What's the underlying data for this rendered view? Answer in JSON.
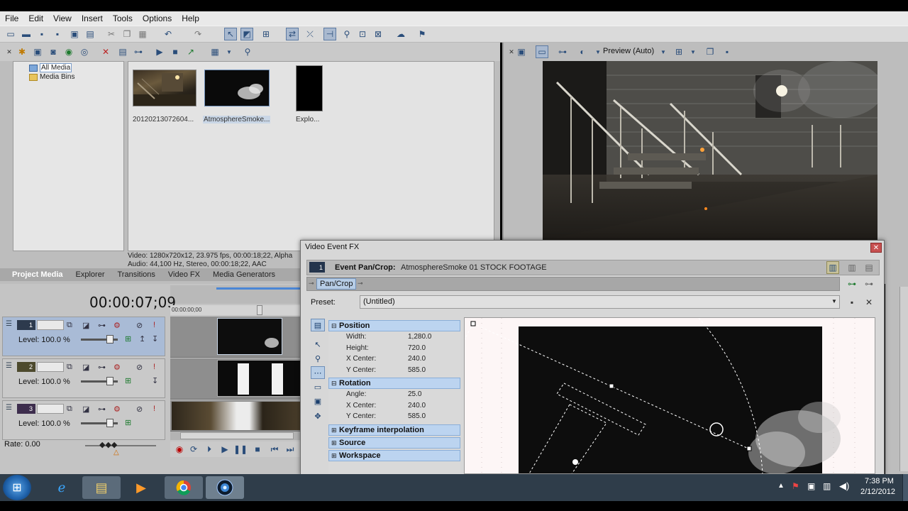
{
  "menubar": {
    "items": [
      "File",
      "Edit",
      "View",
      "Insert",
      "Tools",
      "Options",
      "Help"
    ]
  },
  "project_media": {
    "tree": [
      {
        "label": "All Media",
        "selected": true
      },
      {
        "label": "Media Bins",
        "selected": false
      }
    ],
    "media": [
      {
        "label": "20120213072604...",
        "kind": "video"
      },
      {
        "label": "AtmosphereSmoke...",
        "kind": "smoke"
      },
      {
        "label": "Explo...",
        "kind": "black"
      }
    ],
    "info_video": "Video: 1280x720x12, 23.975 fps, 00:00:18;22, Alpha",
    "info_audio": "Audio: 44,100 Hz, Stereo, 00:00:18;22, AAC"
  },
  "window_tabs": [
    {
      "label": "Project Media",
      "active": true
    },
    {
      "label": "Explorer",
      "active": false
    },
    {
      "label": "Transitions",
      "active": false
    },
    {
      "label": "Video FX",
      "active": false
    },
    {
      "label": "Media Generators",
      "active": false
    }
  ],
  "preview": {
    "quality": "Preview (Auto)"
  },
  "timeline": {
    "timecode": "00:00:07;09",
    "ruler_start": "00:00:00;00",
    "rate_label": "Rate: 0.00",
    "tracks": [
      {
        "number": "1",
        "level": "Level: 100.0 %",
        "selected": true
      },
      {
        "number": "2",
        "level": "Level: 100.0 %",
        "selected": false
      },
      {
        "number": "3",
        "level": "Level: 100.0 %",
        "selected": false
      }
    ]
  },
  "fx_window": {
    "title": "Video Event FX",
    "header_title": "Event Pan/Crop:",
    "header_subtitle": "AtmosphereSmoke 01 STOCK FOOTAGE",
    "chain_tab": "Pan/Crop",
    "preset_label": "Preset:",
    "preset_value": "(Untitled)",
    "sections": [
      {
        "name": "Position",
        "expanded": true,
        "rows": [
          {
            "label": "Width:",
            "value": "1,280.0"
          },
          {
            "label": "Height:",
            "value": "720.0"
          },
          {
            "label": "X Center:",
            "value": "240.0"
          },
          {
            "label": "Y Center:",
            "value": "585.0"
          }
        ]
      },
      {
        "name": "Rotation",
        "expanded": true,
        "rows": [
          {
            "label": "Angle:",
            "value": "25.0"
          },
          {
            "label": "X Center:",
            "value": "240.0"
          },
          {
            "label": "Y Center:",
            "value": "585.0"
          }
        ]
      },
      {
        "name": "Keyframe interpolation",
        "expanded": false,
        "rows": []
      },
      {
        "name": "Source",
        "expanded": false,
        "rows": []
      },
      {
        "name": "Workspace",
        "expanded": false,
        "rows": []
      }
    ]
  },
  "taskbar": {
    "time": "7:38 PM",
    "date": "2/12/2012"
  },
  "colors": {
    "selection_blue": "#bcd4f0",
    "taskbar": "#2f3d4a",
    "panel_gray": "#bdbdbd"
  }
}
